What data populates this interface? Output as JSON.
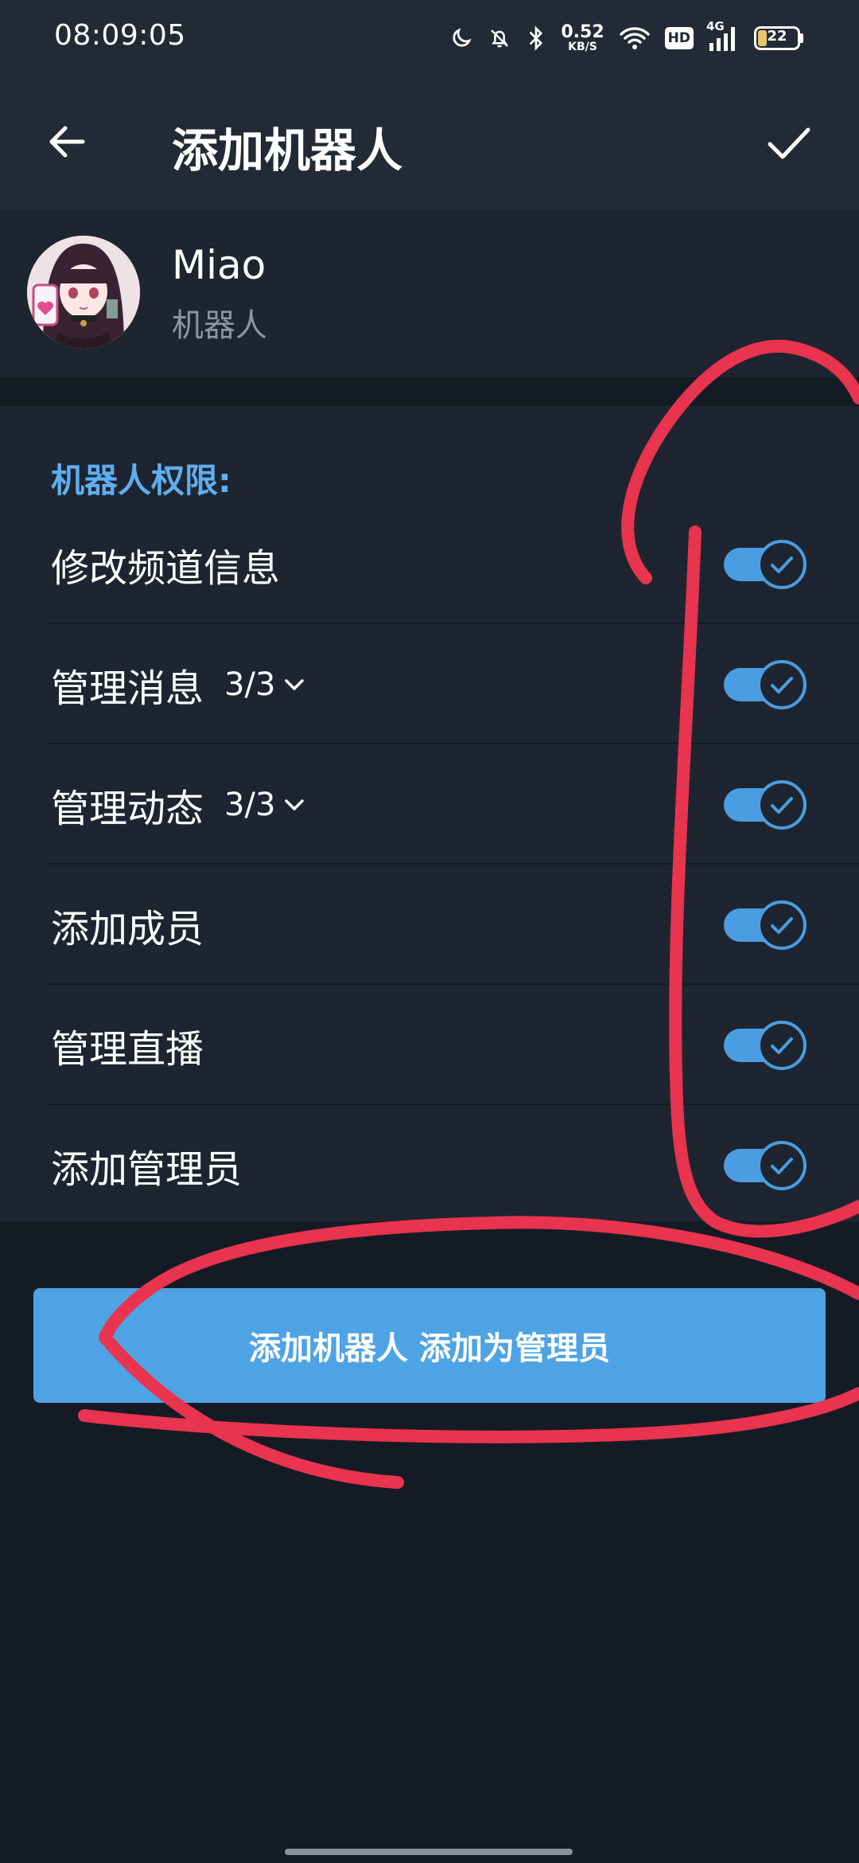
{
  "status_bar": {
    "time": "08:09:05",
    "net_speed_value": "0.52",
    "net_speed_unit": "KB/S",
    "hd": "HD",
    "network": "4G",
    "battery": "22"
  },
  "header": {
    "title": "添加机器人"
  },
  "bot": {
    "name": "Miao",
    "subtitle": "机器人"
  },
  "permissions": {
    "heading": "机器人权限:",
    "items": [
      {
        "label": "修改频道信息",
        "count": "",
        "enabled": true
      },
      {
        "label": "管理消息",
        "count": "3/3",
        "enabled": true
      },
      {
        "label": "管理动态",
        "count": "3/3",
        "enabled": true
      },
      {
        "label": "添加成员",
        "count": "",
        "enabled": true
      },
      {
        "label": "管理直播",
        "count": "",
        "enabled": true
      },
      {
        "label": "添加管理员",
        "count": "",
        "enabled": true
      }
    ]
  },
  "primary_button": {
    "label": "添加机器人 添加为管理员"
  },
  "colors": {
    "accent": "#4ea3e4",
    "heading_blue": "#5eaef0",
    "annotation_red": "#e8344e"
  }
}
